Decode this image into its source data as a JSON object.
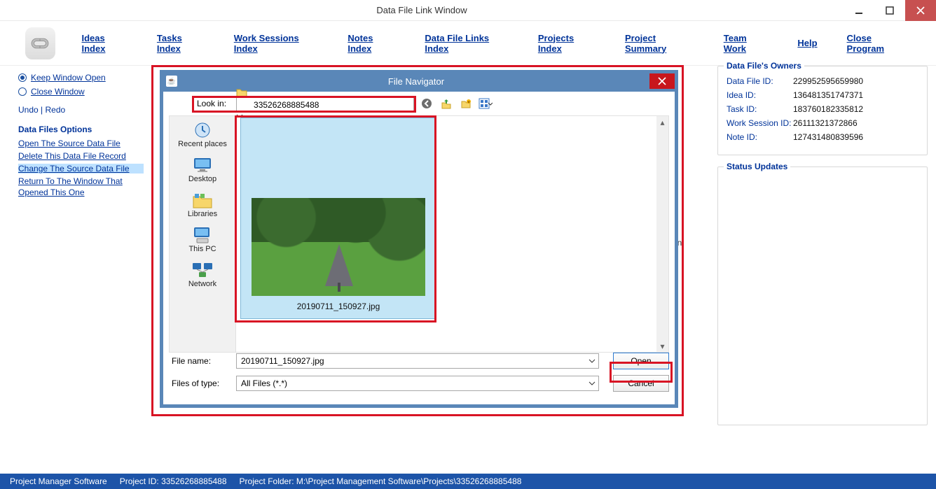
{
  "window": {
    "title": "Data File Link Window"
  },
  "menubar": {
    "ideas": "Ideas Index",
    "tasks": "Tasks Index",
    "work": "Work Sessions Index",
    "notes": "Notes Index",
    "dfl": "Data File Links Index",
    "projects": "Projects Index",
    "summary": "Project Summary",
    "team": "Team Work",
    "help": "Help",
    "close": "Close Program"
  },
  "left": {
    "keep_open": "Keep Window Open",
    "close_window": "Close Window",
    "undo": "Undo",
    "redo": "Redo",
    "options_hd": "Data Files Options",
    "open_src": "Open The Source Data File",
    "delete_rec": "Delete This Data File Record",
    "change_src": "Change The Source Data File",
    "return_win": "Return To The Window That Opened This One"
  },
  "peek": {
    "text": "en"
  },
  "owners": {
    "legend": "Data File's Owners",
    "data_file_id_k": "Data File ID:",
    "data_file_id_v": "229952595659980",
    "idea_id_k": "Idea ID:",
    "idea_id_v": "136481351747371",
    "task_id_k": "Task ID:",
    "task_id_v": "183760182335812",
    "ws_id_k": "Work Session ID:",
    "ws_id_v": "26111321372866",
    "note_id_k": "Note ID:",
    "note_id_v": "127431480839596"
  },
  "status": {
    "legend": "Status Updates"
  },
  "statusbar": {
    "app": "Project Manager Software",
    "project_id": "Project ID:  33526268885488",
    "project_folder": "Project Folder: M:\\Project Management Software\\Projects\\33526268885488"
  },
  "dialog": {
    "title": "File Navigator",
    "lookin_label": "Look in:",
    "lookin_value": "33526268885488",
    "places": {
      "recent": "Recent places",
      "desktop": "Desktop",
      "libraries": "Libraries",
      "thispc": "This PC",
      "network": "Network"
    },
    "thumb_caption": "20190711_150927.jpg",
    "filename_label": "File name:",
    "filename_value": "20190711_150927.jpg",
    "filetype_label": "Files of type:",
    "filetype_value": "All Files (*.*)",
    "open": "Open",
    "cancel": "Cancel"
  }
}
